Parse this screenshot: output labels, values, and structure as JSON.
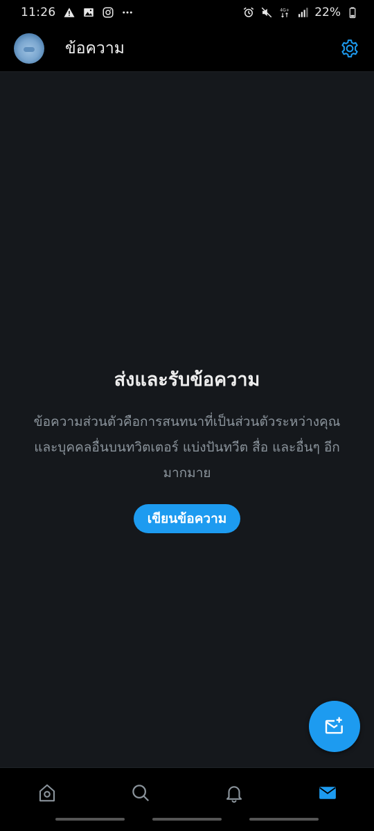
{
  "status_bar": {
    "time": "11:26",
    "left_icons": [
      "warning-icon",
      "image-icon",
      "instagram-icon",
      "more-dots-icon"
    ],
    "right_icons": [
      "alarm-icon",
      "mute-icon",
      "network-4g-icon",
      "signal-icon",
      "battery-icon"
    ],
    "network_label": "4G+",
    "battery": "22%"
  },
  "header": {
    "title": "ข้อความ"
  },
  "empty_state": {
    "title": "ส่งและรับข้อความ",
    "description": "ข้อความส่วนตัวคือการสนทนาที่เป็นส่วนตัวระหว่างคุณและบุคคลอื่นบนทวิตเตอร์ แบ่งปันทวีต สื่อ และอื่นๆ อีกมากมาย",
    "button_label": "เขียนข้อความ"
  },
  "bottom_nav": {
    "items": [
      "home-icon",
      "search-icon",
      "notifications-icon",
      "messages-icon"
    ],
    "active": "messages-icon"
  },
  "colors": {
    "accent": "#1d9bf0",
    "background": "#15181c",
    "bar_background": "#000000"
  }
}
